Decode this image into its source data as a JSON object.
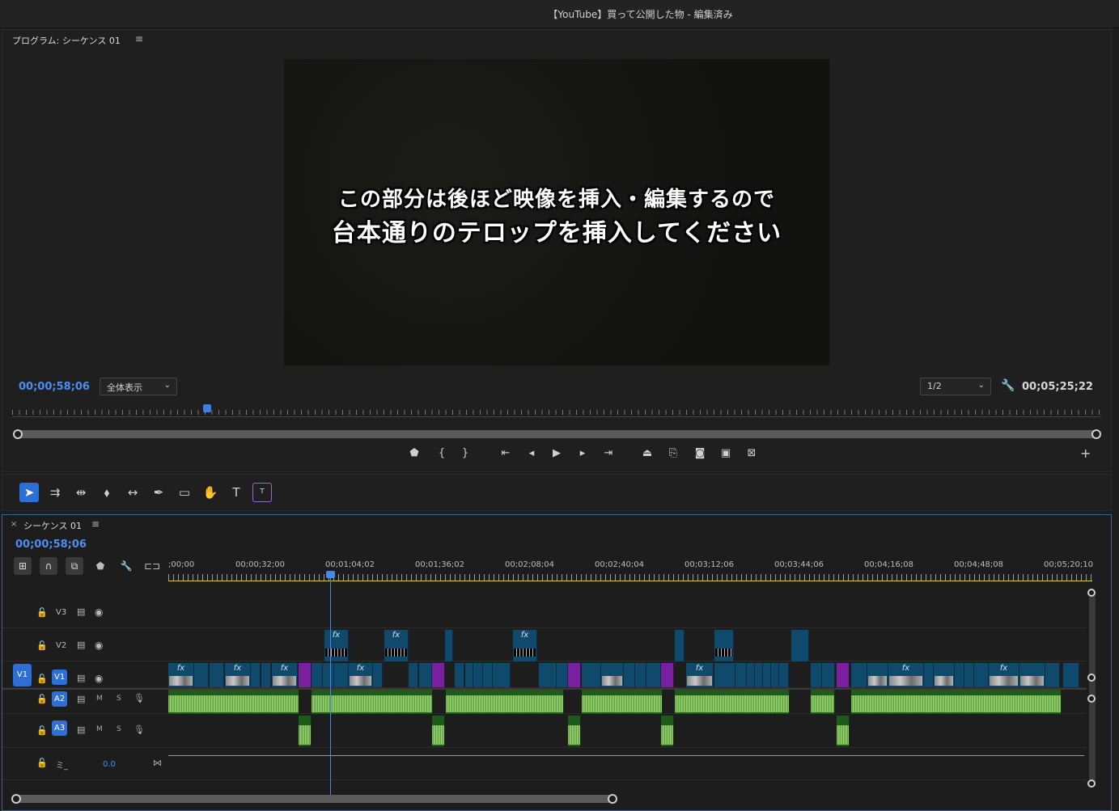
{
  "window": {
    "title": "【YouTube】買って公開した物 - 編集済み"
  },
  "program_monitor": {
    "tab_label": "プログラム: シーケンス 01",
    "caption_line1": "この部分は後ほど映像を挿入・編集するので",
    "caption_line2": "台本通りのテロップを挿入してください",
    "current_timecode": "00;00;58;06",
    "zoom_select": "全体表示",
    "resolution_select": "1/2",
    "duration_timecode": "00;05;25;22"
  },
  "timeline": {
    "tab_label": "シーケンス 01",
    "close_label": "×",
    "current_timecode": "00;00;58;06",
    "ruler_labels": [
      ";00;00",
      "00;00;32;00",
      "00;01;04;02",
      "00;01;36;02",
      "00;02;08;04",
      "00;02;40;04",
      "00;03;12;06",
      "00;03;44;06",
      "00;04;16;08",
      "00;04;48;08",
      "00;05;20;10"
    ],
    "tracks": {
      "v3": "V3",
      "v2": "V2",
      "v1": "V1",
      "v1_source": "V1",
      "a2": "A2",
      "a3": "A3",
      "mix_label": "ミ_",
      "mix_value": "0.0",
      "mute": "M",
      "solo": "S"
    },
    "fx_label": "fx"
  },
  "icons": [
    "menu-icon",
    "wrench-icon",
    "marker-icon",
    "mark-in-icon",
    "mark-out-icon",
    "go-to-in-icon",
    "step-back-icon",
    "play-icon",
    "step-forward-icon",
    "go-to-out-icon",
    "lift-icon",
    "extract-icon",
    "camera-icon",
    "compare-icon",
    "multicam-icon",
    "plus-icon",
    "selection-tool-icon",
    "track-select-icon",
    "ripple-edit-icon",
    "razor-icon",
    "slip-icon",
    "pen-icon",
    "rectangle-icon",
    "hand-icon",
    "type-icon",
    "caption-tool-icon",
    "lock-icon",
    "film-icon",
    "eye-icon",
    "mic-icon"
  ],
  "colors": {
    "accent": "#2d6fd6",
    "timecode": "#4d8ef0",
    "video_clip": "#0f4a6d",
    "nested_clip": "#7a1fa0",
    "audio_clip": "#1e5a1a",
    "playhead": "#4a88e8"
  }
}
